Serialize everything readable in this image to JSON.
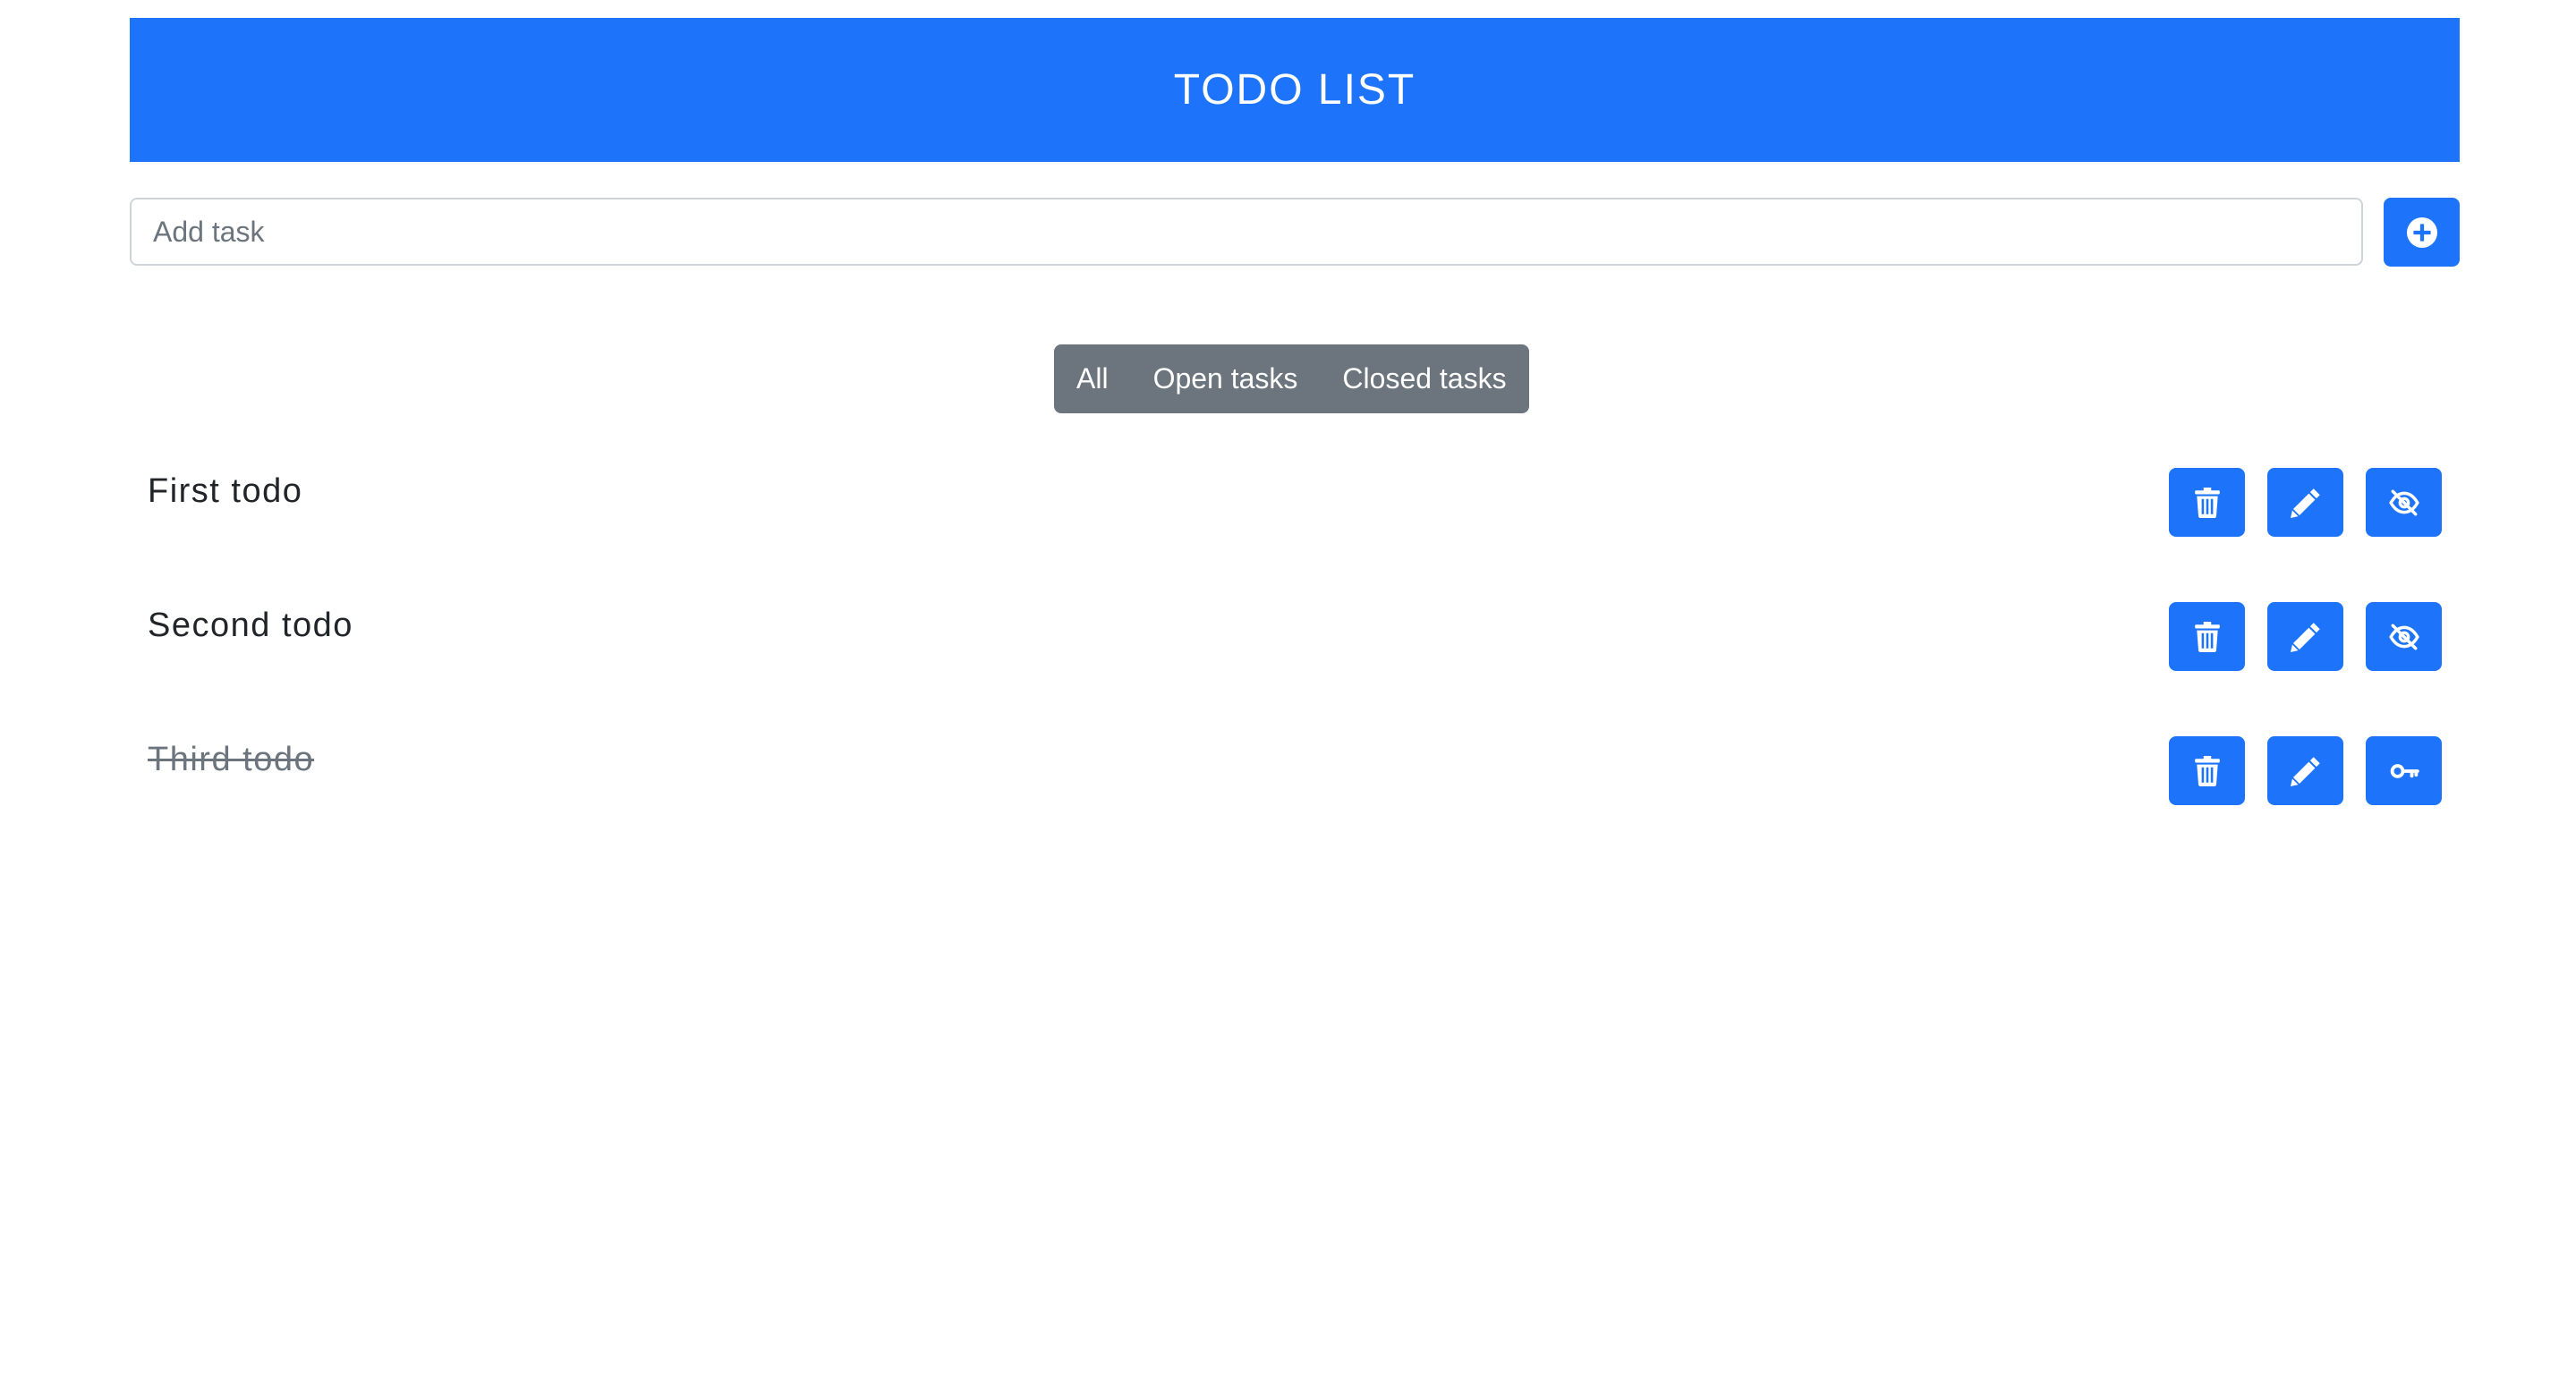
{
  "header": {
    "title": "TODO LIST"
  },
  "add_task": {
    "placeholder": "Add task",
    "value": "",
    "button_icon": "plus-circle-icon"
  },
  "filters": [
    {
      "label": "All"
    },
    {
      "label": "Open tasks"
    },
    {
      "label": "Closed tasks"
    }
  ],
  "todos": [
    {
      "text": "First todo",
      "done": false,
      "toggle_icon": "eye-slash-icon"
    },
    {
      "text": "Second todo",
      "done": false,
      "toggle_icon": "eye-slash-icon"
    },
    {
      "text": "Third todo",
      "done": true,
      "toggle_icon": "key-icon"
    }
  ],
  "colors": {
    "primary": "#1d74fa",
    "secondary": "#6c757d",
    "text": "#212529"
  }
}
